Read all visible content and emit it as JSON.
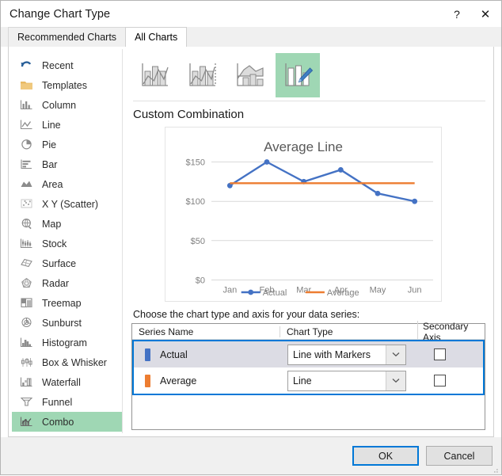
{
  "window": {
    "title": "Change Chart Type",
    "help_label": "?",
    "close_label": "✕"
  },
  "tabs": [
    {
      "label": "Recommended Charts",
      "active": false
    },
    {
      "label": "All Charts",
      "active": true
    }
  ],
  "categories": [
    {
      "label": "Recent",
      "icon": "recent-arrow-icon",
      "selected": false
    },
    {
      "label": "Templates",
      "icon": "folder-icon",
      "selected": false
    },
    {
      "label": "Column",
      "icon": "column-chart-icon",
      "selected": false
    },
    {
      "label": "Line",
      "icon": "line-chart-icon",
      "selected": false
    },
    {
      "label": "Pie",
      "icon": "pie-chart-icon",
      "selected": false
    },
    {
      "label": "Bar",
      "icon": "bar-chart-icon",
      "selected": false
    },
    {
      "label": "Area",
      "icon": "area-chart-icon",
      "selected": false
    },
    {
      "label": "X Y (Scatter)",
      "icon": "scatter-chart-icon",
      "selected": false
    },
    {
      "label": "Map",
      "icon": "map-chart-icon",
      "selected": false
    },
    {
      "label": "Stock",
      "icon": "stock-chart-icon",
      "selected": false
    },
    {
      "label": "Surface",
      "icon": "surface-chart-icon",
      "selected": false
    },
    {
      "label": "Radar",
      "icon": "radar-chart-icon",
      "selected": false
    },
    {
      "label": "Treemap",
      "icon": "treemap-chart-icon",
      "selected": false
    },
    {
      "label": "Sunburst",
      "icon": "sunburst-chart-icon",
      "selected": false
    },
    {
      "label": "Histogram",
      "icon": "histogram-chart-icon",
      "selected": false
    },
    {
      "label": "Box & Whisker",
      "icon": "boxwhisker-icon",
      "selected": false
    },
    {
      "label": "Waterfall",
      "icon": "waterfall-icon",
      "selected": false
    },
    {
      "label": "Funnel",
      "icon": "funnel-chart-icon",
      "selected": false
    },
    {
      "label": "Combo",
      "icon": "combo-chart-icon",
      "selected": true
    }
  ],
  "chart_type_buttons": [
    {
      "name": "clustered-column-line",
      "selected": false
    },
    {
      "name": "clustered-column-line-secondary-axis",
      "selected": false
    },
    {
      "name": "stacked-area-clustered-column",
      "selected": false
    },
    {
      "name": "custom-combination",
      "selected": true
    }
  ],
  "subtitle": "Custom Combination",
  "chart_data": {
    "type": "line",
    "title": "Average Line",
    "xlabel": "",
    "ylabel": "",
    "categories": [
      "Jan",
      "Feb",
      "Mar",
      "Apr",
      "May",
      "Jun"
    ],
    "ylim": [
      0,
      175
    ],
    "yticks": [
      0,
      50,
      100,
      150
    ],
    "ytick_labels": [
      "$0",
      "$50",
      "$100",
      "$150"
    ],
    "grid": true,
    "legend_position": "bottom",
    "series": [
      {
        "name": "Actual",
        "values": [
          120,
          150,
          125,
          140,
          110,
          100
        ],
        "color": "#4472c4",
        "markers": true,
        "chart_type": "Line with Markers"
      },
      {
        "name": "Average",
        "values": [
          123,
          123,
          123,
          123,
          123,
          123
        ],
        "color": "#ed7d31",
        "markers": false,
        "chart_type": "Line"
      }
    ]
  },
  "series_chooser": {
    "instruction": "Choose the chart type and axis for your data series:",
    "columns": [
      "Series Name",
      "Chart Type",
      "Secondary Axis"
    ],
    "rows": [
      {
        "series_name": "Actual",
        "color": "#4472c4",
        "chart_type": "Line with Markers",
        "secondary_axis": false,
        "selected": true
      },
      {
        "series_name": "Average",
        "color": "#ed7d31",
        "chart_type": "Line",
        "secondary_axis": false,
        "selected": false
      }
    ]
  },
  "footer": {
    "ok_label": "OK",
    "cancel_label": "Cancel"
  }
}
